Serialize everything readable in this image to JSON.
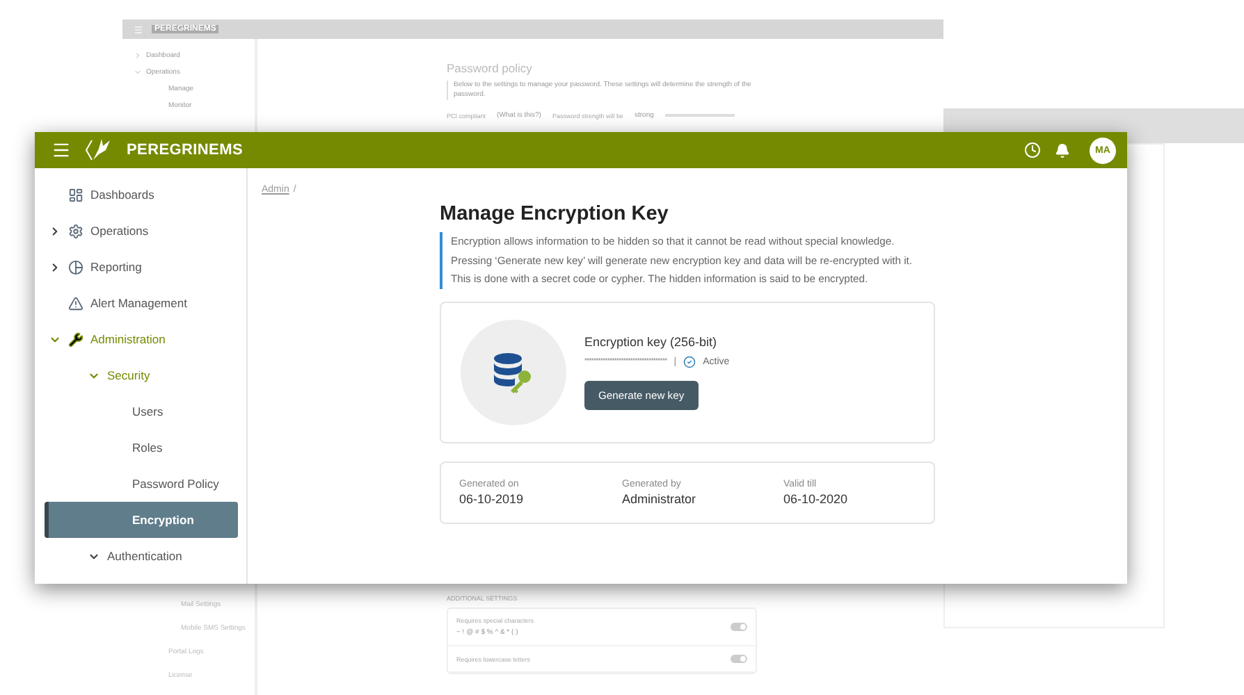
{
  "background_window": {
    "brand": "PEREGRINEMS",
    "nav_top": [
      {
        "label": "Dashboard",
        "expanded": false
      },
      {
        "label": "Operations",
        "expanded": true
      },
      {
        "label": "Manage"
      },
      {
        "label": "Monitor"
      }
    ],
    "page_title": "Password policy",
    "description": "Below to the settings to manage your password. These settings will determine the strength of the password.",
    "pci_label": "PCI compliant",
    "pci_link": "(What is this?)",
    "strength_label": "Password strength will be",
    "strength_value": "strong",
    "nav_bottom": [
      {
        "label": "Mail Settings",
        "kind": "sub"
      },
      {
        "label": "Mobile SMS Settings",
        "kind": "sub"
      },
      {
        "label": "Portal Logs",
        "kind": "top"
      },
      {
        "label": "License",
        "kind": "top"
      }
    ],
    "section_label": "ADDITIONAL SETTINGS",
    "settings": [
      {
        "label": "Requires special characters",
        "hint": "~ ! @ # $ % ^ & * ( )",
        "on": true
      },
      {
        "label": "Requires lowercase letters",
        "on": true
      }
    ]
  },
  "header": {
    "brand": "PEREGRINEMS",
    "avatar": "MA"
  },
  "sidebar": {
    "items": [
      {
        "label": "Dashboards",
        "active": false
      },
      {
        "label": "Operations",
        "active": false,
        "expanded": false
      },
      {
        "label": "Reporting",
        "active": false,
        "expanded": false
      },
      {
        "label": "Alert Management",
        "active": false
      },
      {
        "label": "Administration",
        "active": true,
        "expanded": true,
        "children": [
          {
            "label": "Security",
            "active": true,
            "expanded": true,
            "children": [
              {
                "label": "Users",
                "selected": false
              },
              {
                "label": "Roles",
                "selected": false
              },
              {
                "label": "Password Policy",
                "selected": false
              },
              {
                "label": "Encryption",
                "selected": true
              }
            ]
          },
          {
            "label": "Authentication",
            "active": false,
            "expanded": true
          }
        ]
      }
    ]
  },
  "breadcrumb": {
    "link": "Admin",
    "separator": "/"
  },
  "page_title": "Manage Encryption Key",
  "description": [
    "Encryption allows information to be hidden so that it cannot be read without special knowledge.",
    "Pressing ‘Generate new key’ will generate new encryption key and data will be re-encrypted with it.",
    "This is done with a secret code or cypher. The hidden information is said to be encrypted."
  ],
  "key_card": {
    "title": "Encryption key (256-bit)",
    "masked": "************************************",
    "separator": "|",
    "status": "Active",
    "active": true,
    "button": "Generate new key"
  },
  "details": [
    {
      "label": "Generated on",
      "value": "06-10-2019"
    },
    {
      "label": "Generated by",
      "value": "Administrator"
    },
    {
      "label": "Valid till",
      "value": "06-10-2020"
    }
  ]
}
